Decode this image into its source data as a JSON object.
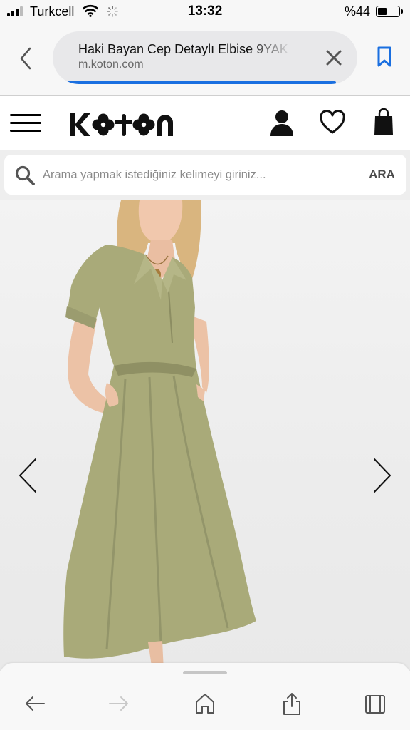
{
  "status_bar": {
    "carrier": "Turkcell",
    "time": "13:32",
    "battery_percent_text": "%44",
    "battery_level": 0.44,
    "icons": [
      "signal-icon",
      "wifi-icon",
      "activity-spinner-icon",
      "battery-icon"
    ]
  },
  "browser": {
    "page_title": "Haki Bayan Cep Detaylı Elbise 9YAK",
    "domain": "m.koton.com",
    "load_progress": 0.95,
    "icons": {
      "back": "chevron-left-icon",
      "clear": "close-icon",
      "bookmark": "bookmark-icon"
    },
    "accent_color": "#1a6fe0"
  },
  "site_header": {
    "logo_text": "KOTON",
    "icons": {
      "menu": "hamburger-menu-icon",
      "account": "user-icon",
      "wishlist": "heart-icon",
      "cart": "shopping-bag-icon"
    }
  },
  "search": {
    "placeholder": "Arama yapmak istediğiniz kelimeyi giriniz...",
    "value": "",
    "button_label": "ARA"
  },
  "product_gallery": {
    "icons": {
      "prev": "chevron-left-icon",
      "next": "chevron-right-icon"
    }
  },
  "bottom_toolbar": {
    "icons": [
      "arrow-left-icon",
      "arrow-right-icon",
      "home-icon",
      "share-icon",
      "tabs-icon"
    ]
  }
}
